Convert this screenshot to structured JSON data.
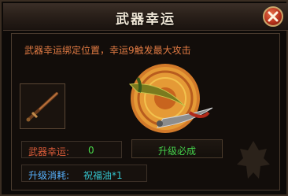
{
  "window": {
    "title": "武器幸运",
    "close_icon": "close-x-icon"
  },
  "description": "武器幸运绑定位置，幸运9触发最大攻击",
  "item_slot": {
    "icon": "sword-icon"
  },
  "preview": {
    "icon": "weapon-emblem-icon"
  },
  "luck": {
    "label": "武器幸运:",
    "value": "0"
  },
  "upgrade_button": {
    "label": "升级必成"
  },
  "cost": {
    "label": "升级消耗:",
    "value": "祝福油*1"
  },
  "colors": {
    "accent_orange": "#e07a43",
    "green": "#45d14b",
    "blue": "#57b2ff",
    "cyan": "#35c7d0",
    "close_red": "#b6321c"
  }
}
